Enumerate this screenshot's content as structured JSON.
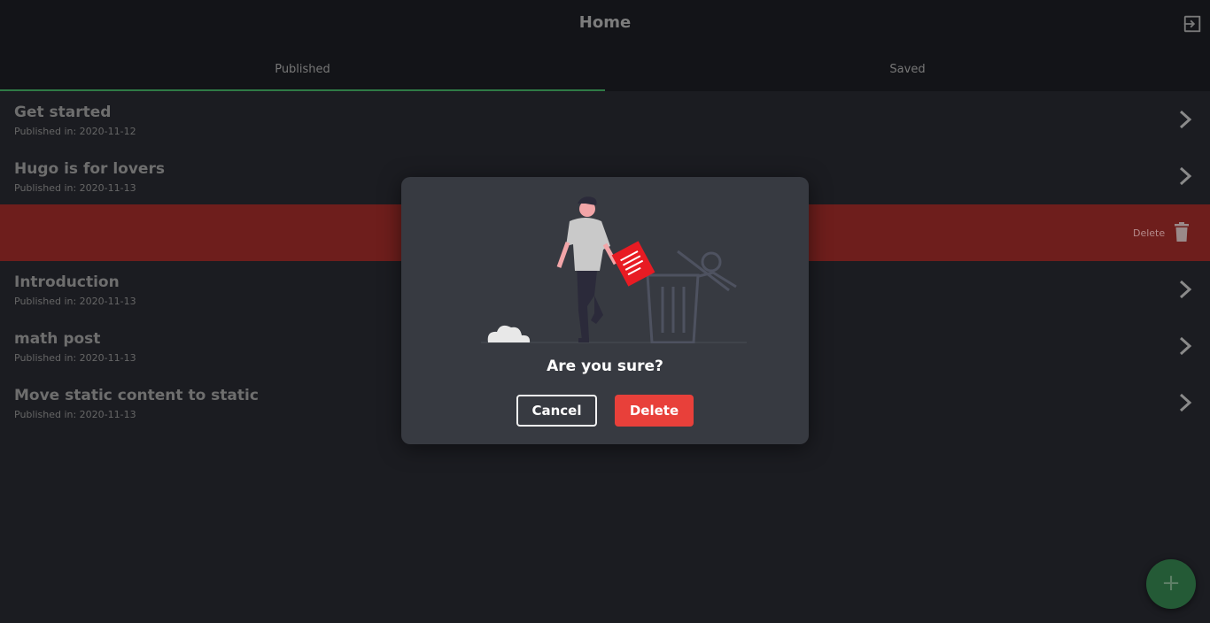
{
  "header": {
    "title": "Home",
    "logout_icon": "logout-icon"
  },
  "tabs": [
    {
      "label": "Published",
      "active": true
    },
    {
      "label": "Saved",
      "active": false
    }
  ],
  "posts": [
    {
      "title": "Get started",
      "date": "Published in: 2020-11-12"
    },
    {
      "title": "Hugo is for lovers",
      "date": "Published in: 2020-11-13"
    },
    {
      "title": "Introduction",
      "date": "Published in: 2020-11-13"
    },
    {
      "title": "math post",
      "date": "Published in: 2020-11-13"
    },
    {
      "title": "Move static content to static",
      "date": "Published in: 2020-11-13"
    }
  ],
  "swipe_row": {
    "delete_label": "Delete"
  },
  "fab": {
    "label": "+"
  },
  "dialog": {
    "question": "Are you sure?",
    "cancel_label": "Cancel",
    "confirm_label": "Delete"
  },
  "colors": {
    "accent": "#2f7a46",
    "danger": "#e8403a",
    "delete_row": "#6e1e1c",
    "background": "#1b1c21"
  }
}
